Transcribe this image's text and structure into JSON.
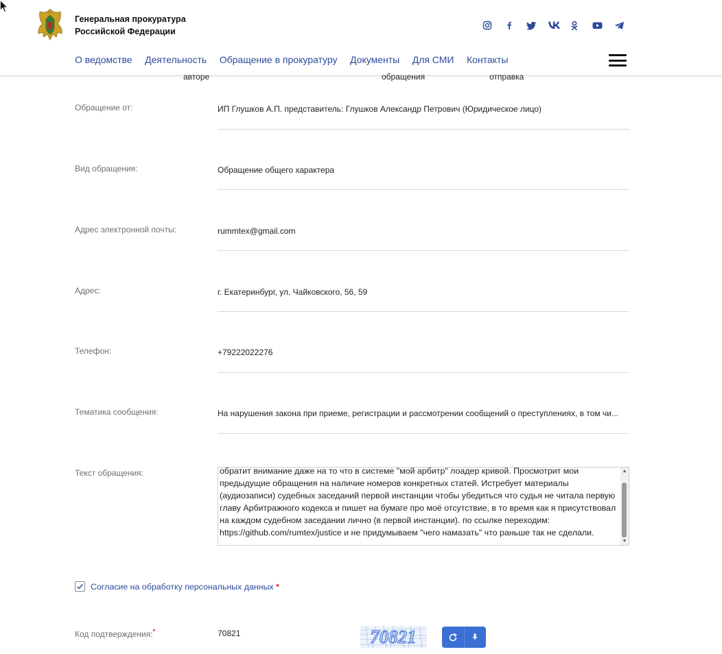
{
  "header": {
    "org_name_line1": "Генеральная прокуратура",
    "org_name_line2": "Российской Федерации",
    "social_icons": [
      "instagram-icon",
      "facebook-icon",
      "twitter-icon",
      "vk-icon",
      "odnoklassniki-icon",
      "youtube-icon",
      "telegram-icon"
    ],
    "nav": [
      {
        "label": "О ведомстве"
      },
      {
        "label": "Деятельность"
      },
      {
        "label": "Обращение в прокуратуру"
      },
      {
        "label": "Документы"
      },
      {
        "label": "Для СМИ"
      },
      {
        "label": "Контакты"
      }
    ]
  },
  "steps": {
    "author": "авторе",
    "appeal": "обращения",
    "send": "отправка"
  },
  "form": {
    "from_label": "Обращение от:",
    "from_value": "ИП Глушков А.П. представитель: Глушков Александр Петрович  (Юридическое лицо)",
    "type_label": "Вид обращения:",
    "type_value": "Обращение общего характера",
    "email_label": "Адрес электронной почты:",
    "email_value": "rummtex@gmail.com",
    "address_label": "Адрес:",
    "address_value": "г. Екатеринбург, ул. Чайковского, 56, 59",
    "phone_label": "Телефон:",
    "phone_value": "+79222022276",
    "topic_label": "Тематика сообщения:",
    "topic_value": "На нарушения закона при приеме, регистрации и рассмотрении сообщений о преступлениях, в том чи...",
    "text_label": "Текст обращения:",
    "text_value": "обратит внимание даже на то что в системе \"мой арбитр\" лоадер кривой. Просмотрит мои предыдущие обращения на наличие номеров конкретных статей. Истребует материалы (аудиозаписи) судебных заседаний первой инстанции чтобы убедиться что судья не читала первую главу Арбитражного кодекса и пишет на бумаге про моё отсутствие, в то время как я присутствовал на каждом судебном заседании лично (в первой инстанции). по ссылке переходим: https://github.com/rumtex/justice и не придумываем \"чего намазать\" что раньше так не сделали.",
    "consent_label": "Согласие на обработку персональных данных",
    "consent_checked": true,
    "required_mark": "*",
    "code_label": "Код подтверждения:",
    "code_value": "70821",
    "captcha_text": "70821"
  },
  "colors": {
    "link": "#2c4a9b",
    "button": "#3b6fd4",
    "required": "#e02424",
    "label": "#6f6f6f"
  }
}
